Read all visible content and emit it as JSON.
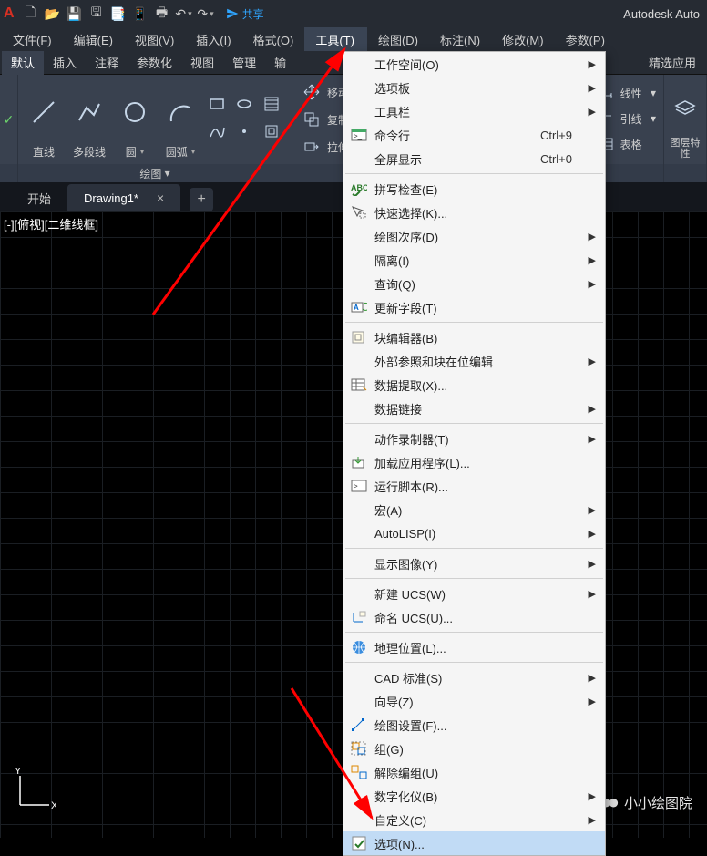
{
  "app_title": "Autodesk Auto",
  "share_label": "共享",
  "menubar": [
    {
      "label": "文件(F)"
    },
    {
      "label": "编辑(E)"
    },
    {
      "label": "视图(V)"
    },
    {
      "label": "插入(I)"
    },
    {
      "label": "格式(O)"
    },
    {
      "label": "工具(T)",
      "active": true
    },
    {
      "label": "绘图(D)"
    },
    {
      "label": "标注(N)"
    },
    {
      "label": "修改(M)"
    },
    {
      "label": "参数(P)"
    }
  ],
  "ribbon_tabs": [
    {
      "label": "默认",
      "active": true
    },
    {
      "label": "插入"
    },
    {
      "label": "注释"
    },
    {
      "label": "参数化"
    },
    {
      "label": "视图"
    },
    {
      "label": "管理"
    },
    {
      "label": "输"
    },
    {
      "label": "精选应用",
      "right": true
    }
  ],
  "ribbon": {
    "draw_panel_label": "绘图",
    "line": "直线",
    "polyline": "多段线",
    "circle": "圆",
    "arc": "圆弧",
    "move": "移动",
    "copy": "复制",
    "stretch": "拉伸",
    "right_items": [
      "线性",
      "引线",
      "表格"
    ],
    "layer_big": "图层特性",
    "left_ribbon_icon": "✓"
  },
  "doc_tabs": {
    "start": "开始",
    "drawing": "Drawing1*"
  },
  "viewport_label": "[-][俯视][二维线框]",
  "dropdown": [
    {
      "label": "工作空间(O)",
      "submenu": true
    },
    {
      "label": "选项板",
      "submenu": true
    },
    {
      "label": "工具栏",
      "submenu": true
    },
    {
      "label": "命令行",
      "shortcut": "Ctrl+9",
      "icon": "cmdline"
    },
    {
      "label": "全屏显示",
      "shortcut": "Ctrl+0"
    },
    {
      "sep": true
    },
    {
      "label": "拼写检查(E)",
      "icon": "spellcheck"
    },
    {
      "label": "快速选择(K)...",
      "icon": "quicksel"
    },
    {
      "label": "绘图次序(D)",
      "submenu": true
    },
    {
      "label": "隔离(I)",
      "submenu": true
    },
    {
      "label": "查询(Q)",
      "submenu": true
    },
    {
      "label": "更新字段(T)",
      "icon": "updatefield"
    },
    {
      "sep": true
    },
    {
      "label": "块编辑器(B)",
      "icon": "blockedit"
    },
    {
      "label": "外部参照和块在位编辑",
      "submenu": true
    },
    {
      "label": "数据提取(X)...",
      "icon": "dataextract"
    },
    {
      "label": "数据链接",
      "submenu": true
    },
    {
      "sep": true
    },
    {
      "label": "动作录制器(T)",
      "submenu": true
    },
    {
      "label": "加载应用程序(L)...",
      "icon": "loadapp"
    },
    {
      "label": "运行脚本(R)...",
      "icon": "script"
    },
    {
      "label": "宏(A)",
      "submenu": true
    },
    {
      "label": "AutoLISP(I)",
      "submenu": true
    },
    {
      "sep": true
    },
    {
      "label": "显示图像(Y)",
      "submenu": true
    },
    {
      "sep": true
    },
    {
      "label": "新建 UCS(W)",
      "submenu": true
    },
    {
      "label": "命名 UCS(U)...",
      "icon": "ucs"
    },
    {
      "sep": true
    },
    {
      "label": "地理位置(L)...",
      "icon": "geo"
    },
    {
      "sep": true
    },
    {
      "label": "CAD 标准(S)",
      "submenu": true
    },
    {
      "label": "向导(Z)",
      "submenu": true
    },
    {
      "label": "绘图设置(F)...",
      "icon": "draftset"
    },
    {
      "label": "组(G)",
      "icon": "group"
    },
    {
      "label": "解除编组(U)",
      "icon": "ungroup"
    },
    {
      "label": "数字化仪(B)",
      "submenu": true
    },
    {
      "label": "自定义(C)",
      "submenu": true
    },
    {
      "label": "选项(N)...",
      "icon": "options",
      "selected": true
    }
  ],
  "watermark": "小小绘图院"
}
